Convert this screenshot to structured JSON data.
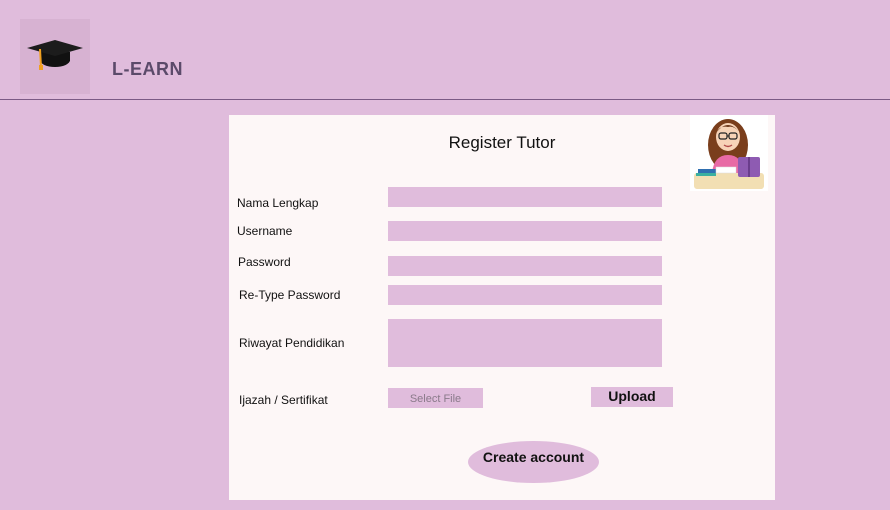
{
  "header": {
    "brand": "L-EARN",
    "logo_icon": "graduation-cap-icon"
  },
  "form": {
    "title": "Register Tutor",
    "illustration": "tutor-reading-illustration",
    "labels": {
      "full_name": "Nama Lengkap",
      "username": "Username",
      "password": "Password",
      "retype_password": "Re-Type Password",
      "education_history": "Riwayat Pendidikan",
      "certificate": "Ijazah / Sertifikat"
    },
    "values": {
      "full_name": "",
      "username": "",
      "password": "",
      "retype_password": "",
      "education_history": ""
    },
    "select_file_label": "Select File",
    "upload_label": "Upload",
    "create_account_label": "Create account"
  },
  "colors": {
    "background": "#e0bcdc",
    "card": "#fdf7f7",
    "accent": "#e0bcdc"
  }
}
